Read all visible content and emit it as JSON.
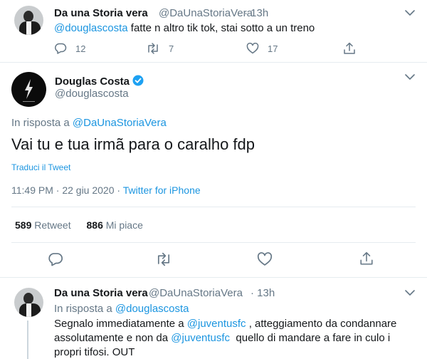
{
  "tweet_top": {
    "name": "Da una Storia vera",
    "handle": "@DaUnaStoriaVera",
    "time": "· 13h",
    "mention": "@douglascosta",
    "text": " fatte n altro tik tok, stai sotto a un treno",
    "replies": "12",
    "retweets": "7",
    "likes": "17"
  },
  "main_tweet": {
    "name": "Douglas Costa",
    "handle": "@douglascosta",
    "reply_prefix": "In risposta a ",
    "reply_to": "@DaUnaStoriaVera",
    "text": "Vai tu e tua irmã para o caralho fdp",
    "translate": "Traduci il Tweet",
    "time": "11:49 PM · 22 giu 2020 ·",
    "source": "Twitter for iPhone",
    "retweet_count": "589",
    "retweet_label": "Retweet",
    "like_count": "886",
    "like_label": "Mi piace"
  },
  "tweet_bottom": {
    "name": "Da una Storia vera",
    "handle": "@DaUnaStoriaVera",
    "time": "· 13h",
    "reply_prefix": "In risposta a ",
    "reply_to": "@douglascosta",
    "line1_a": "Segnalo immediatamente a ",
    "line1_mention": "@juventusfc",
    "line1_b": " , atteggiamento da condannare",
    "line2_a": "assolutamente e non da ",
    "line2_mention": "@juventusfc",
    "line2_b": "  quello di mandare a fare in culo i",
    "line3": "propri tifosi. OUT"
  },
  "colors": {
    "accent": "#1b95e0",
    "secondary_text": "#657786",
    "border": "#e6ecf0"
  },
  "icons": [
    "chevron-down-icon",
    "reply-icon",
    "retweet-icon",
    "like-icon",
    "share-icon",
    "verified-badge-icon"
  ]
}
